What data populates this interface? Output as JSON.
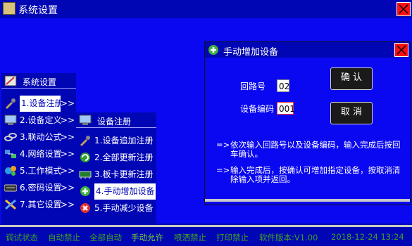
{
  "window": {
    "title": "系统设置"
  },
  "menu1": {
    "header": "系统设置",
    "items": [
      {
        "label": "1.设备注册",
        "icon": "wrench-icon"
      },
      {
        "label": "2.设备定义",
        "icon": "monitor-icon"
      },
      {
        "label": "3.联动公式",
        "icon": "link-icon"
      },
      {
        "label": "4.网络设置",
        "icon": "network-icon"
      },
      {
        "label": "5.工作模式",
        "icon": "gears-icon"
      },
      {
        "label": "6.密码设置",
        "icon": "keyboard-icon"
      },
      {
        "label": "7.其它设置",
        "icon": "tools-icon"
      }
    ],
    "arrow": ">>"
  },
  "menu2": {
    "header": "设备注册",
    "items": [
      {
        "label": "1.设备追加注册",
        "icon": "wrench-icon"
      },
      {
        "label": "2.全部更新注册",
        "icon": "refresh-icon"
      },
      {
        "label": "3.板卡更新注册",
        "icon": "board-icon"
      },
      {
        "label": "4.手动增加设备",
        "icon": "plus-icon"
      },
      {
        "label": "5.手动减少设备",
        "icon": "remove-icon"
      }
    ]
  },
  "dialog": {
    "title": "手动增加设备",
    "loop_label": "回路号",
    "loop_value": "02",
    "code_label": "设备编码",
    "code_value": "001",
    "confirm": "确 认",
    "cancel": "取 消",
    "note1_arrow": "=>",
    "note1": "依次输入回路号以及设备编码，输入完成后按回车确认。",
    "note2_arrow": "=>",
    "note2": "输入完成后，按确认可增加指定设备，按取消清除输入项并返回。"
  },
  "status": {
    "items": [
      "调试状态",
      "自动禁止",
      "全部自动",
      "手动允许",
      "喷洒禁止",
      "打印禁止",
      "软件版本:V1.00",
      "2018-12-24 13:24"
    ]
  },
  "colors": {
    "background": "#0a08f0",
    "bar": "#0006b4",
    "status_text": "#41a020",
    "close": "#ff1010"
  }
}
